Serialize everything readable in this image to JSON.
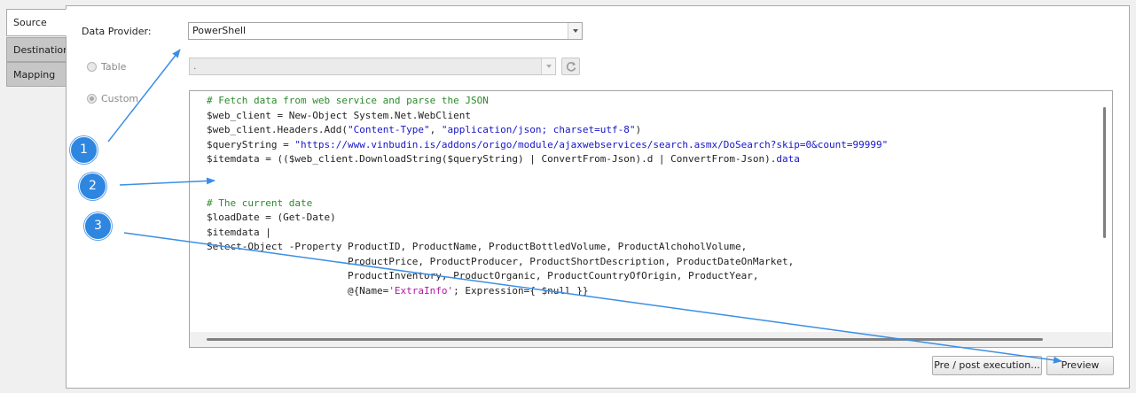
{
  "tabs": [
    {
      "label": "Source",
      "active": true
    },
    {
      "label": "Destination",
      "active": false
    },
    {
      "label": "Mapping",
      "active": false
    }
  ],
  "source": {
    "data_provider_label": "Data Provider:",
    "data_provider_value": "PowerShell",
    "table_option_label": "Table",
    "custom_option_label": "Custom",
    "selected_option": "Custom",
    "table_select_value": "."
  },
  "script_lines": [
    [
      {
        "t": "# Fetch data from web service and parse the JSON",
        "c": "c"
      }
    ],
    [
      {
        "t": "$web_client = New-Object System.Net.WebClient",
        "c": ""
      }
    ],
    [
      {
        "t": "$web_client.Headers.Add(",
        "c": ""
      },
      {
        "t": "\"Content-Type\"",
        "c": "s"
      },
      {
        "t": ", ",
        "c": ""
      },
      {
        "t": "\"application/json; charset=utf-8\"",
        "c": "s"
      },
      {
        "t": ")",
        "c": ""
      }
    ],
    [
      {
        "t": "$queryString = ",
        "c": ""
      },
      {
        "t": "\"https://www.vinbudin.is/addons/origo/module/ajaxwebservices/search.asmx/DoSearch?skip=0&count=99999\"",
        "c": "s"
      }
    ],
    [
      {
        "t": "$itemdata = (($web_client.DownloadString($queryString) | ConvertFrom-Json).d | ConvertFrom-Json).",
        "c": ""
      },
      {
        "t": "data",
        "c": "k"
      }
    ],
    [
      {
        "t": "",
        "c": ""
      }
    ],
    [
      {
        "t": "",
        "c": ""
      }
    ],
    [
      {
        "t": "# The current date",
        "c": "c"
      }
    ],
    [
      {
        "t": "$loadDate = (Get-Date)",
        "c": ""
      }
    ],
    [
      {
        "t": "$itemdata |",
        "c": ""
      }
    ],
    [
      {
        "t": "Select-Object -Property ProductID, ProductName, ProductBottledVolume, ProductAlchoholVolume,",
        "c": ""
      }
    ],
    [
      {
        "t": "                        ProductPrice, ProductProducer, ProductShortDescription, ProductDateOnMarket,",
        "c": ""
      }
    ],
    [
      {
        "t": "                        ProductInventory, ProductOrganic, ProductCountryOfOrigin, ProductYear,",
        "c": ""
      }
    ],
    [
      {
        "t": "                        @{Name=",
        "c": ""
      },
      {
        "t": "'ExtraInfo'",
        "c": "m"
      },
      {
        "t": "; Expression={ $null }}",
        "c": ""
      }
    ]
  ],
  "buttons": {
    "pre_post_label": "Pre / post execution...",
    "preview_label": "Preview"
  },
  "callouts": [
    {
      "number": "1"
    },
    {
      "number": "2"
    },
    {
      "number": "3"
    }
  ],
  "icons": {
    "dropdown": "chevron-down-icon",
    "refresh": "refresh-icon"
  },
  "colors": {
    "callout": "#2e86e0",
    "comment": "#2a8a2a",
    "string": "#1515c8",
    "single_quoted_string": "#b0179f"
  }
}
